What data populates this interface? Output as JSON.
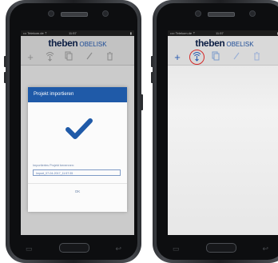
{
  "phones": {
    "left": {
      "status": {
        "carrier": "••• Telekom.de ⇡",
        "time": "11:57",
        "battery": "▮"
      },
      "app": {
        "logo": "theben",
        "logo_sub": "OBELISK"
      },
      "toolbar": {
        "add_icon": "+",
        "import_icon": "import-icon",
        "copy_icon": "copy-icon",
        "edit_icon": "pencil-icon",
        "delete_icon": "trash-icon"
      },
      "dialog": {
        "title": "Projekt importieren",
        "label": "Importiertes Projekt benennen:",
        "input_value": "Import_07-04-2017_11:57:35",
        "ok_label": "OK"
      }
    },
    "right": {
      "status": {
        "carrier": "•••• Telekom.de ⇡",
        "time": "11:57",
        "battery": "▮"
      },
      "app": {
        "logo": "theben",
        "logo_sub": "OBELISK"
      },
      "toolbar": {
        "add_icon": "+",
        "import_icon": "import-icon",
        "copy_icon": "copy-icon",
        "edit_icon": "pencil-icon",
        "delete_icon": "trash-icon",
        "highlight": "import-icon"
      }
    }
  },
  "colors": {
    "accent": "#1f5aa8",
    "highlight_ring": "#d42a2a",
    "logo_dark": "#0d1f44"
  }
}
